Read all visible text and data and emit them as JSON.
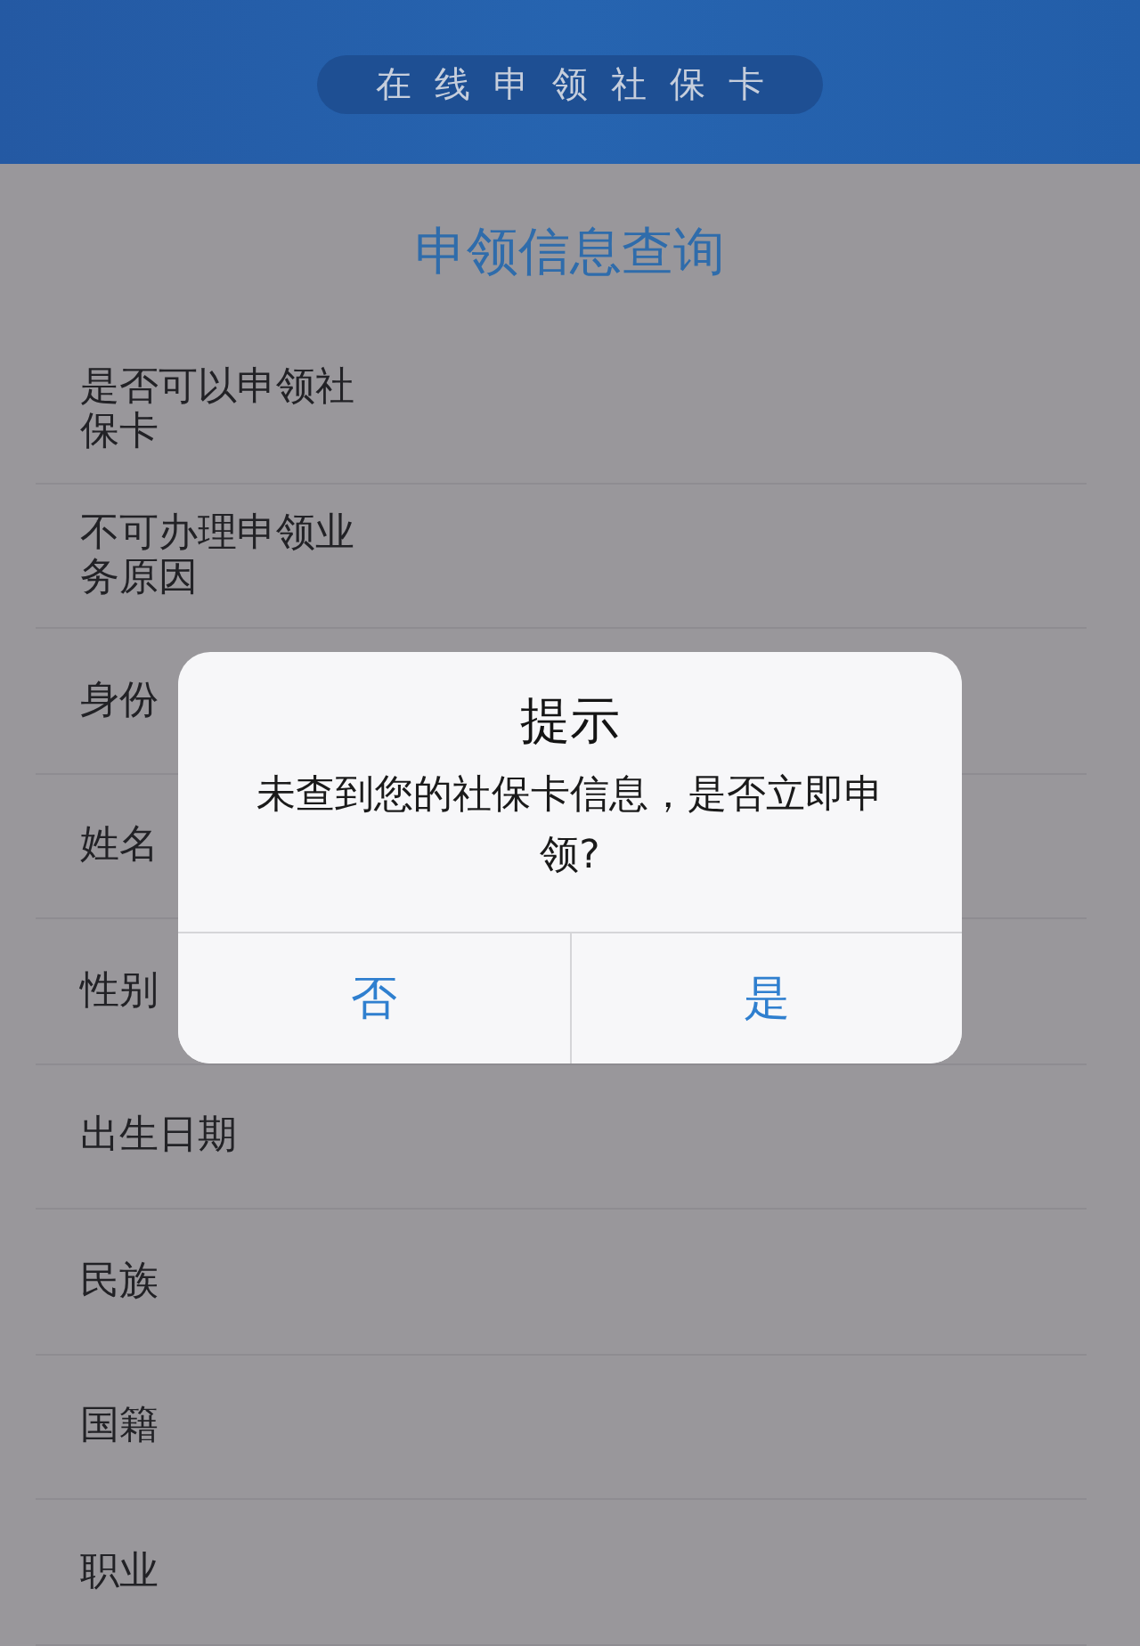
{
  "banner": {
    "slogan": "在线申领社保卡"
  },
  "page_title": "申领信息查询",
  "fields": [
    {
      "label": "是否可以申领社保卡"
    },
    {
      "label": "不可办理申领业务原因"
    },
    {
      "label": "身份"
    },
    {
      "label": "姓名"
    },
    {
      "label": "性别"
    },
    {
      "label": "出生日期"
    },
    {
      "label": "民族"
    },
    {
      "label": "国籍"
    },
    {
      "label": "职业"
    }
  ],
  "dialog": {
    "title": "提示",
    "message": "未查到您的社保卡信息，是否立即申领?",
    "buttons": [
      "否",
      "是"
    ]
  }
}
